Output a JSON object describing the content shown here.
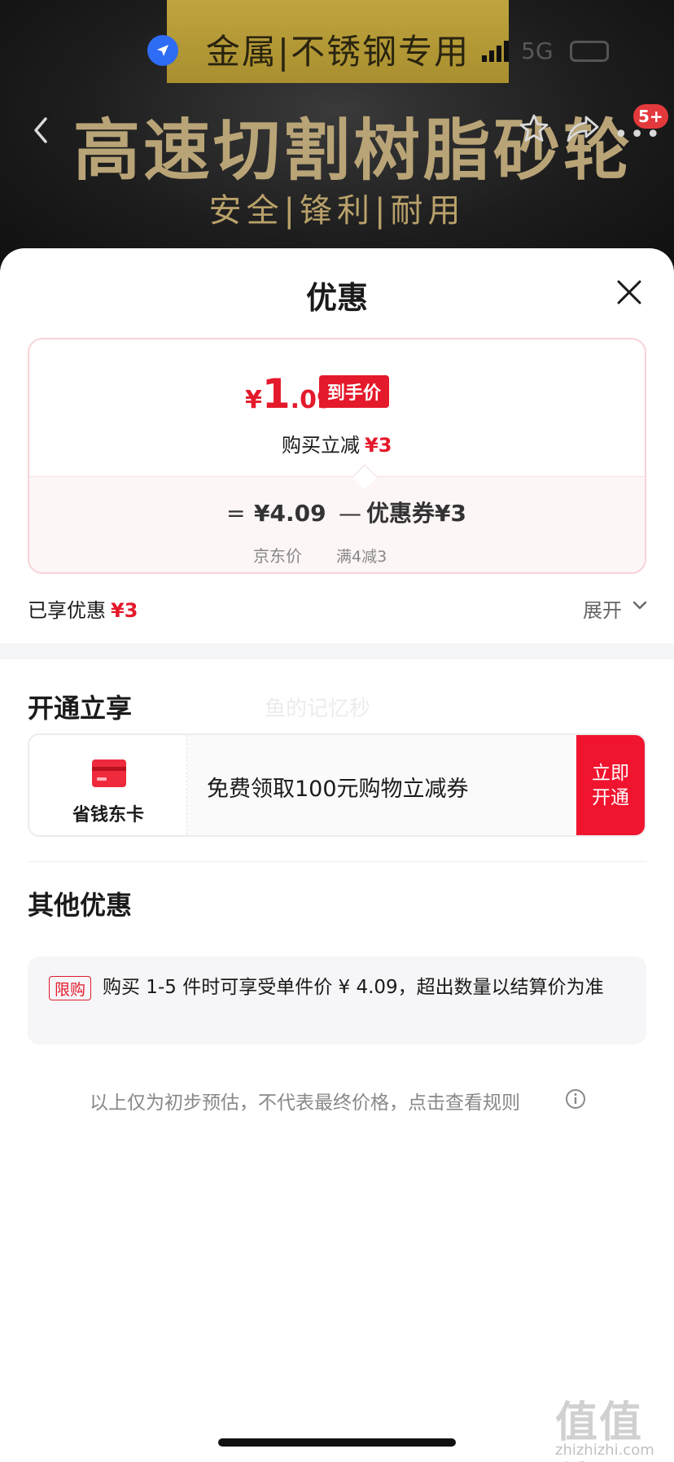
{
  "backdrop": {
    "banner_top": "金属|不锈钢专用",
    "headline": "高速切割树脂砂轮",
    "subline": "安全|锋利|耐用",
    "status_network": "5G",
    "badge": "5+"
  },
  "sheet": {
    "title": "优惠",
    "final_price": {
      "currency": "¥",
      "integer": "1",
      "decimal": ".09"
    },
    "final_price_tag": "到手价",
    "instant_cut_label": "购买立减",
    "instant_cut_value": "¥3",
    "formula": {
      "equals": "=",
      "jd_price": "¥4.09",
      "minus": "—",
      "coupon": "优惠券¥3",
      "jd_price_label": "京东价",
      "coupon_label": "满4减3"
    },
    "enjoyed_label": "已享优惠",
    "enjoyed_value": "¥3",
    "expand_label": "展开"
  },
  "open_section": {
    "title": "开通立享",
    "watermark": "鱼的记忆秒",
    "card_name": "省钱东卡",
    "description": "免费领取100元购物立减券",
    "button": "立即开通"
  },
  "other_section": {
    "title": "其他优惠",
    "tag": "限购",
    "text": "购买 1-5 件时可享受单件价 ¥ 4.09，超出数量以结算价为准"
  },
  "disclaimer": "以上仅为初步预估，不代表最终价格，点击查看规则",
  "site_watermark": {
    "big": "值值值",
    "small": "zhizhizhi.com"
  },
  "colors": {
    "accent": "#e4192b",
    "button": "#f0142f",
    "gold": "#b9a477"
  },
  "icons": [
    "location-icon",
    "signal-icon",
    "battery-icon",
    "back-icon",
    "star-icon",
    "share-icon",
    "more-icon",
    "close-icon",
    "chevron-down-icon",
    "card-icon",
    "info-icon"
  ]
}
